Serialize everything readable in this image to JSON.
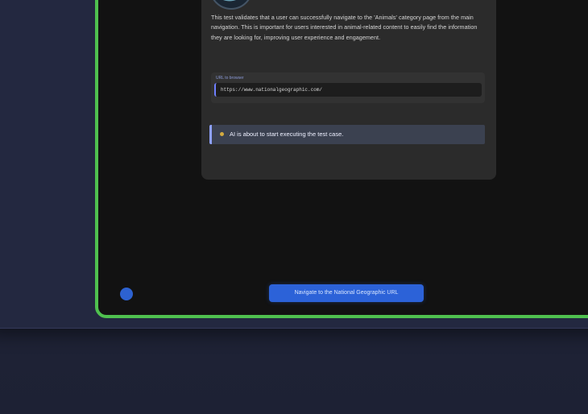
{
  "card": {
    "author_name": "",
    "description": "This test validates that a user can successfully navigate to the 'Animals' category page from the main navigation. This is important for users interested in animal-related content to easily find the information they are looking for, improving user experience and engagement.",
    "url_label": "URL to browser",
    "url_value": "https://www.nationalgeographic.com/",
    "status_text": "AI is about to start executing the test case."
  },
  "bottom_action": {
    "label": "Navigate to the National Geographic URL"
  },
  "icons": {
    "top_action": "top-action-icon",
    "zoom": "zoom-in-icon",
    "status": "status-dot-icon",
    "indicator": "status-indicator-icon"
  },
  "colors": {
    "frame_border": "#4fc14f",
    "accent": "#2c62d8",
    "panel_bg": "#2b2b2b",
    "status_border": "#8ea1ff",
    "page_bg": "#1f2336"
  }
}
